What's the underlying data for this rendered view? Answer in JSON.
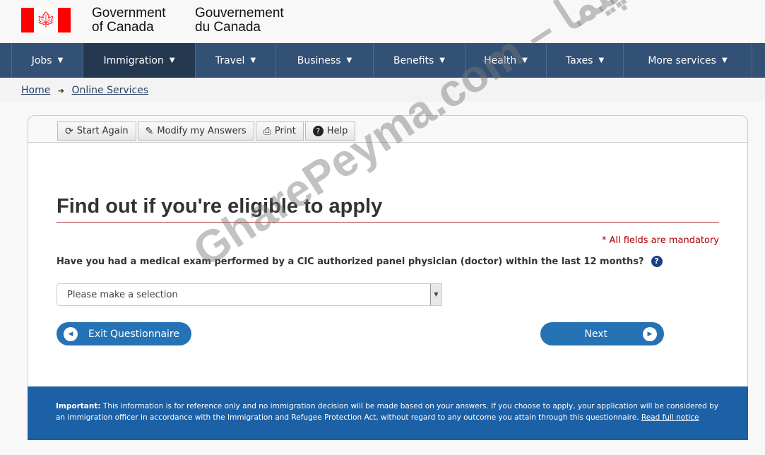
{
  "header": {
    "en_line1": "Government",
    "en_line2": "of Canada",
    "fr_line1": "Gouvernement",
    "fr_line2": "du Canada",
    "flag_colors": {
      "red": "#ff0000",
      "white": "#ffffff"
    }
  },
  "nav": {
    "items": [
      {
        "label": "Jobs"
      },
      {
        "label": "Immigration",
        "active": true
      },
      {
        "label": "Travel"
      },
      {
        "label": "Business"
      },
      {
        "label": "Benefits"
      },
      {
        "label": "Health"
      },
      {
        "label": "Taxes"
      },
      {
        "label": "More services"
      }
    ],
    "color": "#335075"
  },
  "breadcrumb": {
    "home": "Home",
    "current": "Online Services"
  },
  "toolbar": {
    "start_again": "Start Again",
    "modify": "Modify my Answers",
    "print": "Print",
    "help": "Help"
  },
  "main": {
    "title": "Find out if you're eligible to apply",
    "mandatory": "* All fields are mandatory",
    "question": "Have you had a medical exam performed by a CIC authorized panel physician (doctor) within the last 12 months?",
    "select_value": "Please make a selection",
    "exit": "Exit Questionnaire",
    "next": "Next"
  },
  "footer": {
    "important": "Important:",
    "text": " This information is for reference only and no immigration decision will be made based on your answers. If you choose to apply, your application will be considered by an immigration officer in accordance with the Immigration and Refugee Protection Act, without regard to any outcome you attain through this questionnaire. ",
    "link": "Read full notice"
  }
}
